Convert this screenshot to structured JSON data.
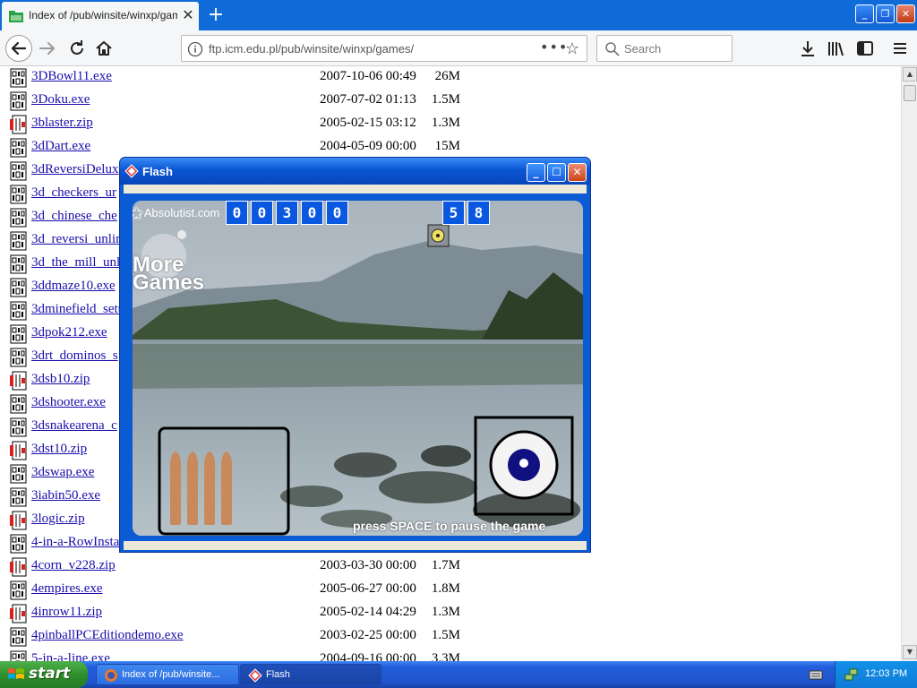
{
  "browser": {
    "tab_title": "Index of /pub/winsite/winxp/games/",
    "url": "ftp.icm.edu.pl/pub/winsite/winxp/games/",
    "search_placeholder": "Search",
    "icons": {
      "back": "arrow-left-icon",
      "forward": "arrow-right-icon",
      "reload": "reload-icon",
      "home": "home-icon",
      "page_actions": "more-dots-icon",
      "bookmark": "star-icon",
      "downloads": "download-icon",
      "library": "library-icon",
      "sidebar": "sidebar-icon",
      "menu": "hamburger-menu-icon"
    }
  },
  "files": [
    {
      "name": "3DBowl11.exe",
      "date": "2007-10-06 00:49",
      "size": "26M",
      "type": "exe"
    },
    {
      "name": "3Doku.exe",
      "date": "2007-07-02 01:13",
      "size": "1.5M",
      "type": "exe"
    },
    {
      "name": "3blaster.zip",
      "date": "2005-02-15 03:12",
      "size": "1.3M",
      "type": "zip"
    },
    {
      "name": "3dDart.exe",
      "date": "2004-05-09 00:00",
      "size": "15M",
      "type": "exe"
    },
    {
      "name": "3dReversiDelux",
      "date": "",
      "size": "",
      "type": "exe"
    },
    {
      "name": "3d_checkers_ur",
      "date": "",
      "size": "",
      "type": "exe"
    },
    {
      "name": "3d_chinese_che",
      "date": "",
      "size": "",
      "type": "exe"
    },
    {
      "name": "3d_reversi_unlin",
      "date": "",
      "size": "",
      "type": "exe"
    },
    {
      "name": "3d_the_mill_unli",
      "date": "",
      "size": "",
      "type": "exe"
    },
    {
      "name": "3ddmaze10.exe",
      "date": "",
      "size": "",
      "type": "exe"
    },
    {
      "name": "3dminefield_setu",
      "date": "",
      "size": "",
      "type": "exe"
    },
    {
      "name": "3dpok212.exe",
      "date": "",
      "size": "",
      "type": "exe"
    },
    {
      "name": "3drt_dominos_s",
      "date": "",
      "size": "",
      "type": "exe"
    },
    {
      "name": "3dsb10.zip",
      "date": "",
      "size": "",
      "type": "zip"
    },
    {
      "name": "3dshooter.exe",
      "date": "",
      "size": "",
      "type": "exe"
    },
    {
      "name": "3dsnakearena_c",
      "date": "",
      "size": "",
      "type": "exe"
    },
    {
      "name": "3dst10.zip",
      "date": "",
      "size": "",
      "type": "zip"
    },
    {
      "name": "3dswap.exe",
      "date": "",
      "size": "",
      "type": "exe"
    },
    {
      "name": "3iabin50.exe",
      "date": "",
      "size": "",
      "type": "exe"
    },
    {
      "name": "3logic.zip",
      "date": "",
      "size": "",
      "type": "zip"
    },
    {
      "name": "4-in-a-RowInsta",
      "date": "",
      "size": "",
      "type": "exe"
    },
    {
      "name": "4corn_v228.zip",
      "date": "2003-03-30 00:00",
      "size": "1.7M",
      "type": "zip"
    },
    {
      "name": "4empires.exe",
      "date": "2005-06-27 00:00",
      "size": "1.8M",
      "type": "exe"
    },
    {
      "name": "4inrow11.zip",
      "date": "2005-02-14 04:29",
      "size": "1.3M",
      "type": "zip"
    },
    {
      "name": "4pinballPCEditiondemo.exe",
      "date": "2003-02-25 00:00",
      "size": "1.5M",
      "type": "exe"
    },
    {
      "name": "5-in-a-line.exe",
      "date": "2004-09-16 00:00",
      "size": "3.3M",
      "type": "exe"
    }
  ],
  "flash_window": {
    "title": "Flash",
    "game": {
      "logo_text": "Absolutist.com",
      "score_digits": [
        "0",
        "0",
        "3",
        "0",
        "0"
      ],
      "timer_digits": [
        "5",
        "8"
      ],
      "more_games": "More Games",
      "pause_hint": "press SPACE to pause the game",
      "bullets_remaining": 4
    }
  },
  "taskbar": {
    "start_label": "start",
    "items": [
      {
        "label": "Index of /pub/winsite...",
        "icon": "firefox-icon"
      },
      {
        "label": "Flash",
        "icon": "flash-icon"
      }
    ],
    "clock": "12:03 PM"
  }
}
